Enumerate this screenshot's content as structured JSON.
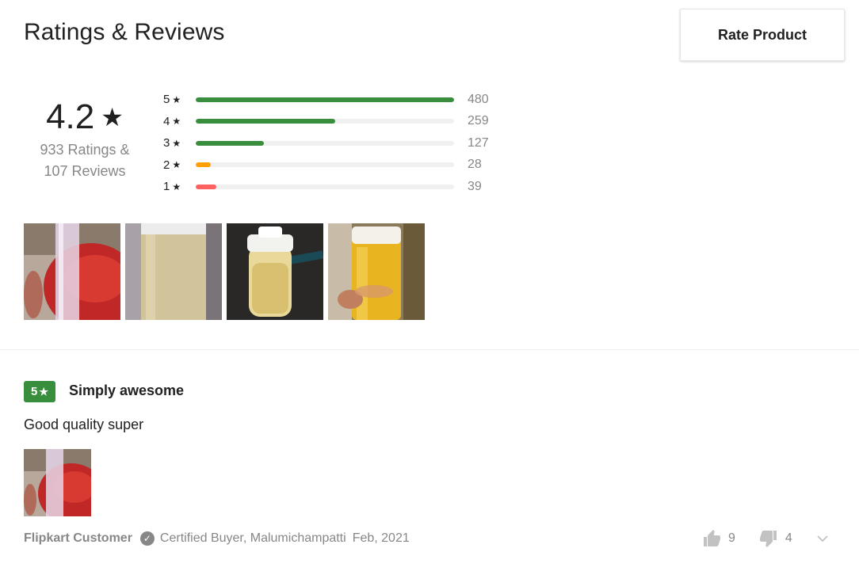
{
  "header": {
    "title": "Ratings & Reviews",
    "rate_button": "Rate Product"
  },
  "summary": {
    "average": "4.2",
    "star": "★",
    "ratings_text": "933 Ratings &",
    "reviews_text": "107 Reviews"
  },
  "breakdown": [
    {
      "label": "5",
      "count": "480",
      "fraction": 1.0,
      "color": "#388e3c"
    },
    {
      "label": "4",
      "count": "259",
      "fraction": 0.54,
      "color": "#388e3c"
    },
    {
      "label": "3",
      "count": "127",
      "fraction": 0.265,
      "color": "#388e3c"
    },
    {
      "label": "2",
      "count": "28",
      "fraction": 0.058,
      "color": "#ff9f00"
    },
    {
      "label": "1",
      "count": "39",
      "fraction": 0.081,
      "color": "#ff6161"
    }
  ],
  "review": {
    "rating": "5",
    "title": "Simply awesome",
    "text": "Good quality super",
    "author": "Flipkart Customer",
    "certified": "Certified Buyer, Malumichampatti",
    "date": "Feb, 2021",
    "likes": "9",
    "dislikes": "4"
  }
}
